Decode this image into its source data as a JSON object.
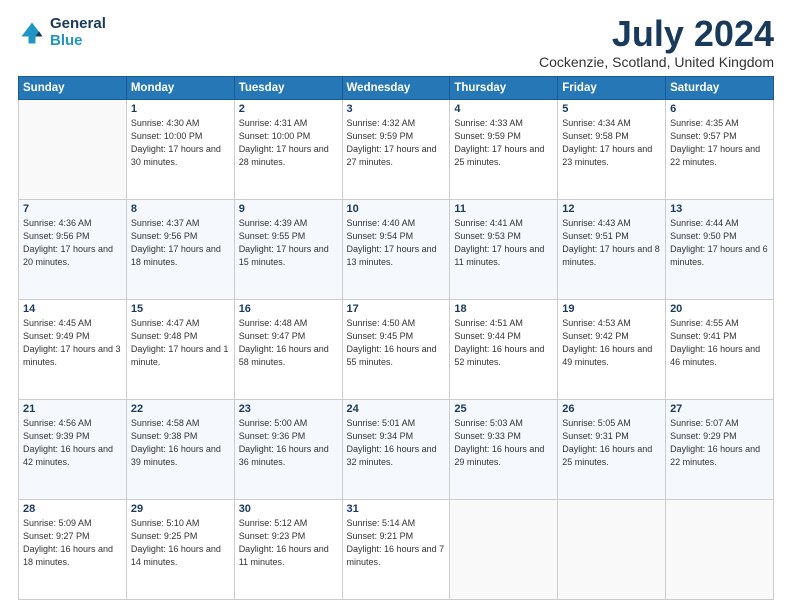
{
  "logo": {
    "line1": "General",
    "line2": "Blue"
  },
  "title": "July 2024",
  "location": "Cockenzie, Scotland, United Kingdom",
  "days_header": [
    "Sunday",
    "Monday",
    "Tuesday",
    "Wednesday",
    "Thursday",
    "Friday",
    "Saturday"
  ],
  "weeks": [
    [
      {
        "day": "",
        "sunrise": "",
        "sunset": "",
        "daylight": ""
      },
      {
        "day": "1",
        "sunrise": "Sunrise: 4:30 AM",
        "sunset": "Sunset: 10:00 PM",
        "daylight": "Daylight: 17 hours and 30 minutes."
      },
      {
        "day": "2",
        "sunrise": "Sunrise: 4:31 AM",
        "sunset": "Sunset: 10:00 PM",
        "daylight": "Daylight: 17 hours and 28 minutes."
      },
      {
        "day": "3",
        "sunrise": "Sunrise: 4:32 AM",
        "sunset": "Sunset: 9:59 PM",
        "daylight": "Daylight: 17 hours and 27 minutes."
      },
      {
        "day": "4",
        "sunrise": "Sunrise: 4:33 AM",
        "sunset": "Sunset: 9:59 PM",
        "daylight": "Daylight: 17 hours and 25 minutes."
      },
      {
        "day": "5",
        "sunrise": "Sunrise: 4:34 AM",
        "sunset": "Sunset: 9:58 PM",
        "daylight": "Daylight: 17 hours and 23 minutes."
      },
      {
        "day": "6",
        "sunrise": "Sunrise: 4:35 AM",
        "sunset": "Sunset: 9:57 PM",
        "daylight": "Daylight: 17 hours and 22 minutes."
      }
    ],
    [
      {
        "day": "7",
        "sunrise": "Sunrise: 4:36 AM",
        "sunset": "Sunset: 9:56 PM",
        "daylight": "Daylight: 17 hours and 20 minutes."
      },
      {
        "day": "8",
        "sunrise": "Sunrise: 4:37 AM",
        "sunset": "Sunset: 9:56 PM",
        "daylight": "Daylight: 17 hours and 18 minutes."
      },
      {
        "day": "9",
        "sunrise": "Sunrise: 4:39 AM",
        "sunset": "Sunset: 9:55 PM",
        "daylight": "Daylight: 17 hours and 15 minutes."
      },
      {
        "day": "10",
        "sunrise": "Sunrise: 4:40 AM",
        "sunset": "Sunset: 9:54 PM",
        "daylight": "Daylight: 17 hours and 13 minutes."
      },
      {
        "day": "11",
        "sunrise": "Sunrise: 4:41 AM",
        "sunset": "Sunset: 9:53 PM",
        "daylight": "Daylight: 17 hours and 11 minutes."
      },
      {
        "day": "12",
        "sunrise": "Sunrise: 4:43 AM",
        "sunset": "Sunset: 9:51 PM",
        "daylight": "Daylight: 17 hours and 8 minutes."
      },
      {
        "day": "13",
        "sunrise": "Sunrise: 4:44 AM",
        "sunset": "Sunset: 9:50 PM",
        "daylight": "Daylight: 17 hours and 6 minutes."
      }
    ],
    [
      {
        "day": "14",
        "sunrise": "Sunrise: 4:45 AM",
        "sunset": "Sunset: 9:49 PM",
        "daylight": "Daylight: 17 hours and 3 minutes."
      },
      {
        "day": "15",
        "sunrise": "Sunrise: 4:47 AM",
        "sunset": "Sunset: 9:48 PM",
        "daylight": "Daylight: 17 hours and 1 minute."
      },
      {
        "day": "16",
        "sunrise": "Sunrise: 4:48 AM",
        "sunset": "Sunset: 9:47 PM",
        "daylight": "Daylight: 16 hours and 58 minutes."
      },
      {
        "day": "17",
        "sunrise": "Sunrise: 4:50 AM",
        "sunset": "Sunset: 9:45 PM",
        "daylight": "Daylight: 16 hours and 55 minutes."
      },
      {
        "day": "18",
        "sunrise": "Sunrise: 4:51 AM",
        "sunset": "Sunset: 9:44 PM",
        "daylight": "Daylight: 16 hours and 52 minutes."
      },
      {
        "day": "19",
        "sunrise": "Sunrise: 4:53 AM",
        "sunset": "Sunset: 9:42 PM",
        "daylight": "Daylight: 16 hours and 49 minutes."
      },
      {
        "day": "20",
        "sunrise": "Sunrise: 4:55 AM",
        "sunset": "Sunset: 9:41 PM",
        "daylight": "Daylight: 16 hours and 46 minutes."
      }
    ],
    [
      {
        "day": "21",
        "sunrise": "Sunrise: 4:56 AM",
        "sunset": "Sunset: 9:39 PM",
        "daylight": "Daylight: 16 hours and 42 minutes."
      },
      {
        "day": "22",
        "sunrise": "Sunrise: 4:58 AM",
        "sunset": "Sunset: 9:38 PM",
        "daylight": "Daylight: 16 hours and 39 minutes."
      },
      {
        "day": "23",
        "sunrise": "Sunrise: 5:00 AM",
        "sunset": "Sunset: 9:36 PM",
        "daylight": "Daylight: 16 hours and 36 minutes."
      },
      {
        "day": "24",
        "sunrise": "Sunrise: 5:01 AM",
        "sunset": "Sunset: 9:34 PM",
        "daylight": "Daylight: 16 hours and 32 minutes."
      },
      {
        "day": "25",
        "sunrise": "Sunrise: 5:03 AM",
        "sunset": "Sunset: 9:33 PM",
        "daylight": "Daylight: 16 hours and 29 minutes."
      },
      {
        "day": "26",
        "sunrise": "Sunrise: 5:05 AM",
        "sunset": "Sunset: 9:31 PM",
        "daylight": "Daylight: 16 hours and 25 minutes."
      },
      {
        "day": "27",
        "sunrise": "Sunrise: 5:07 AM",
        "sunset": "Sunset: 9:29 PM",
        "daylight": "Daylight: 16 hours and 22 minutes."
      }
    ],
    [
      {
        "day": "28",
        "sunrise": "Sunrise: 5:09 AM",
        "sunset": "Sunset: 9:27 PM",
        "daylight": "Daylight: 16 hours and 18 minutes."
      },
      {
        "day": "29",
        "sunrise": "Sunrise: 5:10 AM",
        "sunset": "Sunset: 9:25 PM",
        "daylight": "Daylight: 16 hours and 14 minutes."
      },
      {
        "day": "30",
        "sunrise": "Sunrise: 5:12 AM",
        "sunset": "Sunset: 9:23 PM",
        "daylight": "Daylight: 16 hours and 11 minutes."
      },
      {
        "day": "31",
        "sunrise": "Sunrise: 5:14 AM",
        "sunset": "Sunset: 9:21 PM",
        "daylight": "Daylight: 16 hours and 7 minutes."
      },
      {
        "day": "",
        "sunrise": "",
        "sunset": "",
        "daylight": ""
      },
      {
        "day": "",
        "sunrise": "",
        "sunset": "",
        "daylight": ""
      },
      {
        "day": "",
        "sunrise": "",
        "sunset": "",
        "daylight": ""
      }
    ]
  ]
}
